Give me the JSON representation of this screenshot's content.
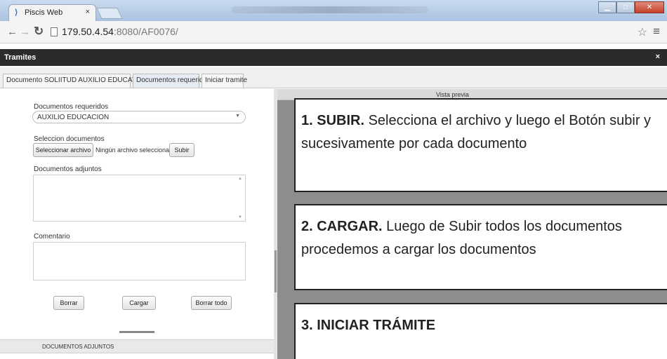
{
  "browser": {
    "tab_title": "Piscis Web",
    "tab_close": "×",
    "url_host": "179.50.4.54",
    "url_rest": ":8080/AF0076/"
  },
  "app": {
    "title": "Tramites",
    "close": "×",
    "tabs": [
      {
        "label": "Documento SOLIITUD AUXILIO EDUCATIVO"
      },
      {
        "label": "Documentos requeridos"
      },
      {
        "label": "Iniciar tramite"
      }
    ]
  },
  "form": {
    "required_label": "Documentos requeridos",
    "required_value": "AUXILIO EDUCACION",
    "select_label": "Seleccion documentos",
    "choose_file_button": "Seleccionar archivo",
    "no_file_text": "Ningún archivo seleccionado",
    "upload_button": "Subir",
    "attached_label": "Documentos adjuntos",
    "comment_label": "Comentario",
    "delete_button": "Borrar",
    "load_button": "Cargar",
    "delete_all_button": "Borrar todo",
    "attached_header": "DOCUMENTOS ADJUNTOS"
  },
  "preview": {
    "header": "Vista previa",
    "notes": [
      {
        "num": "1. SUBIR.",
        "text": " Selecciona el archivo y luego el Botón subir y sucesivamente por cada documento"
      },
      {
        "num": "2. CARGAR.",
        "text": " Luego de Subir todos los documentos procedemos a cargar los documentos"
      },
      {
        "num": "3. INICIAR TRÁMITE",
        "text": ""
      }
    ]
  },
  "colors": {
    "appbar": "#2b2b2b",
    "preview_bg": "#8d8d8d",
    "chrome_titlebar": "#b8cde6"
  }
}
